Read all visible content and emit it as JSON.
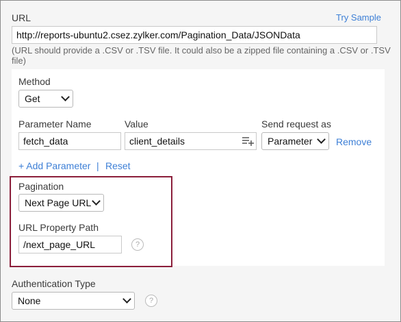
{
  "url_section": {
    "label": "URL",
    "try_sample": "Try Sample",
    "value": "http://reports-ubuntu2.csez.zylker.com/Pagination_Data/JSONData",
    "hint": "(URL should provide a .CSV or .TSV file. It could also be a zipped file containing a .CSV or .TSV file)"
  },
  "method": {
    "label": "Method",
    "value": "Get"
  },
  "params": {
    "name_header": "Parameter Name",
    "value_header": "Value",
    "send_header": "Send request as",
    "name_value": "fetch_data",
    "value_value": "client_details",
    "send_value": "Parameter",
    "remove": "Remove",
    "add": "+ Add Parameter",
    "separator": "|",
    "reset": "Reset"
  },
  "pagination": {
    "label": "Pagination",
    "value": "Next Page URL",
    "property_label": "URL Property Path",
    "property_value": "/next_page_URL",
    "help": "?"
  },
  "auth": {
    "label": "Authentication Type",
    "value": "None",
    "help": "?"
  },
  "icons": {
    "insert_variable": "insert-variable-icon",
    "chevron": "chevron-down-icon",
    "help": "help-icon"
  },
  "colors": {
    "link": "#3d7fd6",
    "highlight": "#8b1e3a"
  }
}
